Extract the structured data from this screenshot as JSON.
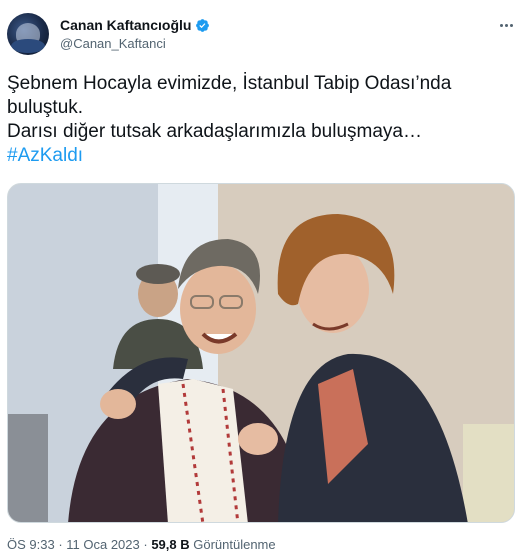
{
  "author": {
    "display_name": "Canan Kaftancıoğlu",
    "handle": "@Canan_Kaftanci",
    "verified_color": "#1d9bf0"
  },
  "tweet": {
    "lines": [
      "Şebnem Hocayla evimizde, İstanbul Tabip Odası’nda",
      "buluştuk.",
      "Darısı diğer tutsak arkadaşlarımızla buluşmaya…"
    ],
    "hashtag": "#AzKaldı"
  },
  "meta": {
    "time": "ÖS 9:33",
    "separator1": " · ",
    "date": "11 Oca 2023",
    "separator2": " · ",
    "views_count": "59,8 B",
    "views_label": " Görüntülenme"
  },
  "colors": {
    "link": "#1d9bf0",
    "secondary_text": "#536471",
    "primary_text": "#0f1419"
  },
  "icons": {
    "verified": "verified-badge-icon",
    "more": "more-options-icon"
  }
}
